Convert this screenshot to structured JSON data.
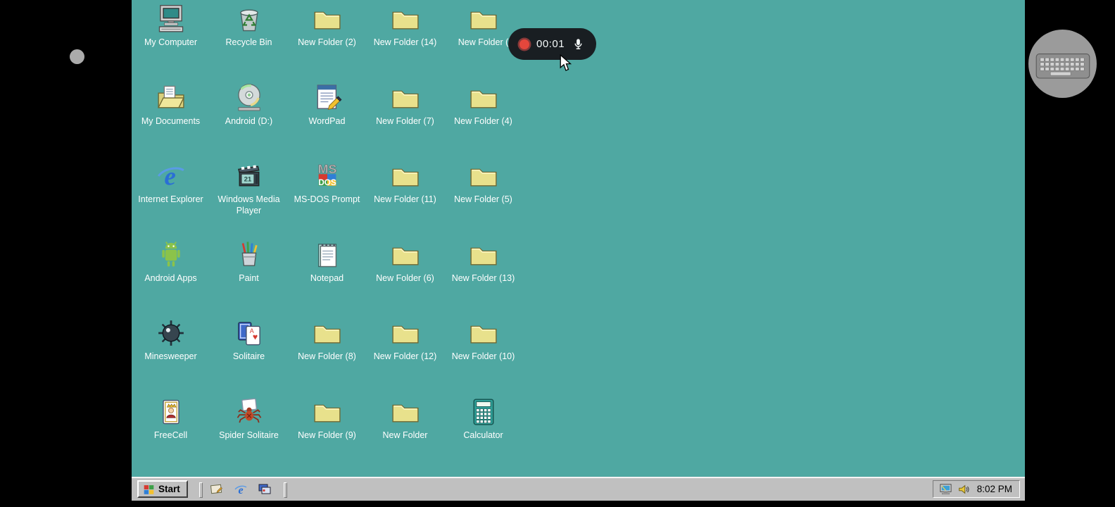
{
  "colors": {
    "desktop_bg": "#4FA8A2",
    "taskbar_bg": "#C0C0C0",
    "icon_label_text": "#FFFFFF",
    "folder_yellow": "#E8E18C",
    "pill_bg": "#16161B",
    "record_red": "#EF4136"
  },
  "recording_pill": {
    "time": "00:01",
    "record_icon": "record-dot",
    "mic_icon": "microphone"
  },
  "side_controls": {
    "left_button_icon": "dot",
    "right_button_icon": "keyboard"
  },
  "desktop": {
    "columns": [
      {
        "items": [
          {
            "icon": "my-computer",
            "label": "My Computer"
          },
          {
            "icon": "my-documents",
            "label": "My Documents"
          },
          {
            "icon": "internet-explorer",
            "label": "Internet Explorer"
          },
          {
            "icon": "android-apps",
            "label": "Android Apps"
          },
          {
            "icon": "minesweeper",
            "label": "Minesweeper"
          },
          {
            "icon": "freecell",
            "label": "FreeCell"
          }
        ]
      },
      {
        "items": [
          {
            "icon": "recycle-bin",
            "label": "Recycle Bin"
          },
          {
            "icon": "cd-drive",
            "label": "Android (D:)"
          },
          {
            "icon": "media-player",
            "label": "Windows Media Player"
          },
          {
            "icon": "paint",
            "label": "Paint"
          },
          {
            "icon": "solitaire",
            "label": "Solitaire"
          },
          {
            "icon": "spider-solitaire",
            "label": "Spider Solitaire"
          }
        ]
      },
      {
        "items": [
          {
            "icon": "folder",
            "label": "New Folder (2)"
          },
          {
            "icon": "wordpad",
            "label": "WordPad"
          },
          {
            "icon": "msdos",
            "label": "MS-DOS Prompt"
          },
          {
            "icon": "notepad",
            "label": "Notepad"
          },
          {
            "icon": "folder",
            "label": "New Folder (8)"
          },
          {
            "icon": "folder",
            "label": "New Folder (9)"
          }
        ]
      },
      {
        "items": [
          {
            "icon": "folder",
            "label": "New Folder (14)"
          },
          {
            "icon": "folder",
            "label": "New Folder (7)"
          },
          {
            "icon": "folder",
            "label": "New Folder (11)"
          },
          {
            "icon": "folder",
            "label": "New Folder (6)"
          },
          {
            "icon": "folder",
            "label": "New Folder (12)"
          },
          {
            "icon": "folder",
            "label": "New Folder"
          }
        ]
      },
      {
        "items": [
          {
            "icon": "folder",
            "label": "New Folder ("
          },
          {
            "icon": "folder",
            "label": "New Folder (4)"
          },
          {
            "icon": "folder",
            "label": "New Folder (5)"
          },
          {
            "icon": "folder",
            "label": "New Folder (13)"
          },
          {
            "icon": "folder",
            "label": "New Folder (10)"
          },
          {
            "icon": "calculator",
            "label": "Calculator"
          }
        ]
      }
    ]
  },
  "taskbar": {
    "start_label": "Start",
    "quick_launch": [
      {
        "icon": "show-desktop"
      },
      {
        "icon": "internet-explorer-small"
      },
      {
        "icon": "channels"
      }
    ],
    "tray": {
      "icons": [
        "display",
        "volume"
      ],
      "clock": "8:02 PM"
    }
  }
}
